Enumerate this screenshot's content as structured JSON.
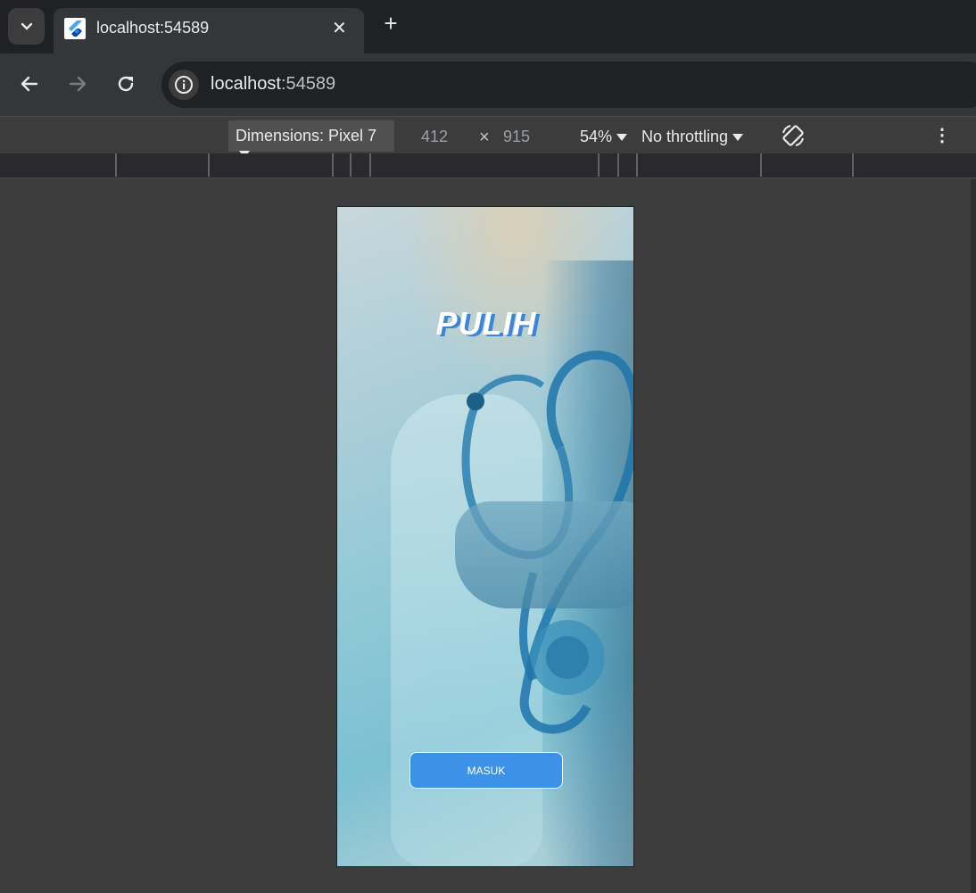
{
  "browser": {
    "tab": {
      "title": "localhost:54589",
      "close_glyph": "✕"
    },
    "new_tab_glyph": "+",
    "omnibox": {
      "host": "localhost",
      "port": ":54589"
    }
  },
  "device_toolbar": {
    "dimensions_label": "Dimensions: Pixel 7",
    "width": "412",
    "times_glyph": "×",
    "height": "915",
    "zoom": "54%",
    "throttling": "No throttling",
    "more_glyph": "⋮"
  },
  "app": {
    "title": "PULIH",
    "login_button": "MASUK"
  },
  "colors": {
    "button_blue": "#3d91e6",
    "title_shadow": "#3b86d6"
  },
  "icons": {
    "tab_search": "chevron-down-icon",
    "favicon": "flutter-icon",
    "back": "arrow-left-icon",
    "forward": "arrow-right-icon",
    "reload": "reload-icon",
    "site_info": "info-icon",
    "rotate": "rotate-icon",
    "more": "kebab-menu-icon"
  }
}
